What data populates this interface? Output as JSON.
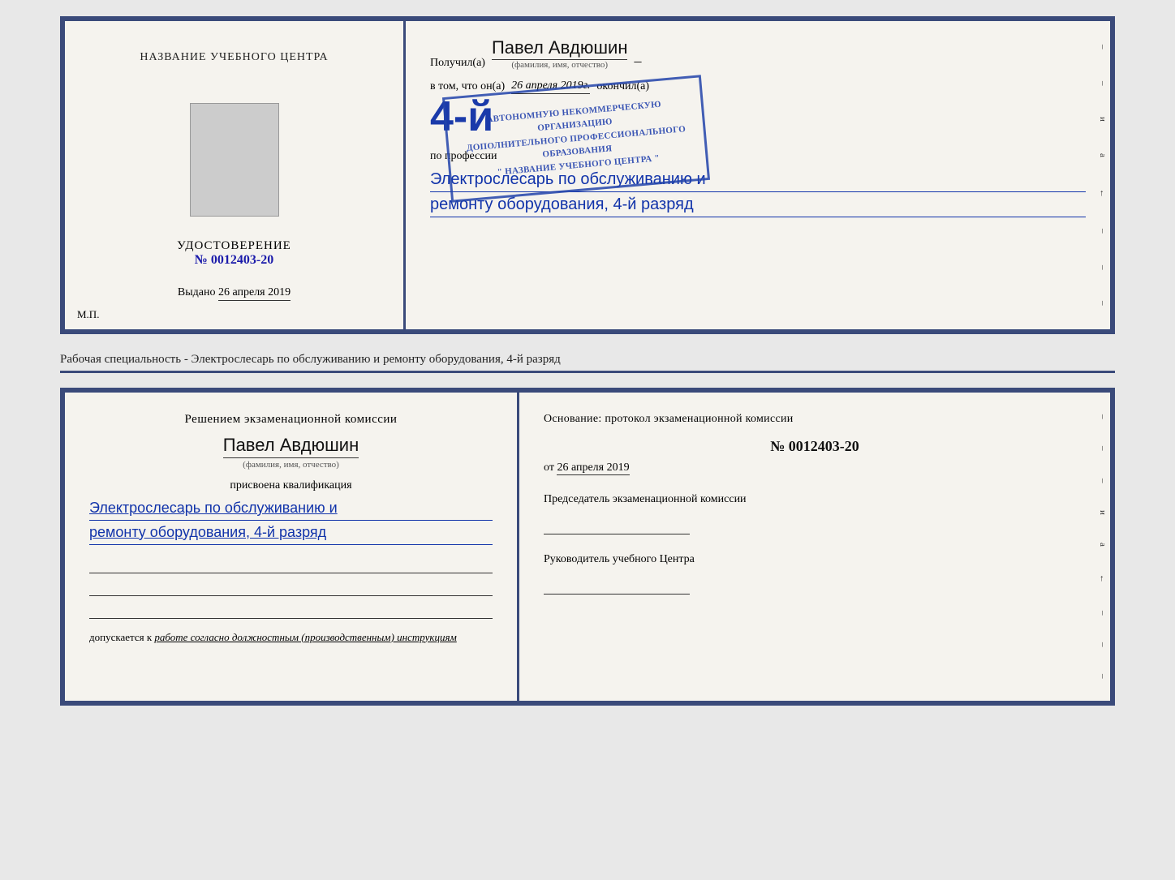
{
  "top_cert": {
    "left": {
      "title": "НАЗВАНИЕ УЧЕБНОГО ЦЕНТРА",
      "udostoverenie_label": "УДОСТОВЕРЕНИЕ",
      "number": "№ 0012403-20",
      "vydano_label": "Выдано",
      "vydano_date": "26 апреля 2019",
      "mp_label": "М.П."
    },
    "right": {
      "recipient_prefix": "Получил(а)",
      "recipient_name": "Павел Авдюшин",
      "dash": "–",
      "fio_label": "(фамилия, имя, отчество)",
      "vtom_prefix": "в том, что он(а)",
      "vtom_date": "26 апреля 2019г.",
      "okonchil": "окончил(а)",
      "rank": "4-й",
      "org_line1": "АВТОНОМНУЮ НЕКОММЕРЧЕСКУЮ ОРГАНИЗАЦИЮ",
      "org_line2": "ДОПОЛНИТЕЛЬНОГО ПРОФЕССИОНАЛЬНОГО ОБРАЗОВАНИЯ",
      "org_line3": "\" НАЗВАНИЕ УЧЕБНОГО ЦЕНТРА \"",
      "po_professii": "по профессии",
      "profession_line1": "Электрослесарь по обслуживанию и",
      "profession_line2": "ремонту оборудования, 4-й разряд"
    },
    "edge_marks": [
      "–",
      "–",
      "и",
      "а",
      "←",
      "–",
      "–",
      "–"
    ]
  },
  "middle_text": "Рабочая специальность - Электрослесарь по обслуживанию и ремонту оборудования, 4-й разряд",
  "bottom_cert": {
    "left": {
      "resheniem_label": "Решением экзаменационной  комиссии",
      "person_name": "Павел Авдюшин",
      "fio_label": "(фамилия, имя, отчество)",
      "prisvoena_label": "присвоена квалификация",
      "qualification_line1": "Электрослесарь по обслуживанию и",
      "qualification_line2": "ремонту оборудования, 4-й разряд",
      "dopuskaetsya_prefix": "допускается к",
      "dopuskaetsya_text": "работе согласно должностным (производственным) инструкциям"
    },
    "right": {
      "osnovanie_label": "Основание: протокол экзаменационной  комиссии",
      "protocol_number": "№  0012403-20",
      "ot_prefix": "от",
      "ot_date": "26 апреля 2019",
      "predsedatel_label": "Председатель экзаменационной комиссии",
      "rukovoditel_label": "Руководитель учебного Центра"
    },
    "edge_marks": [
      "–",
      "–",
      "–",
      "и",
      "а",
      "←",
      "–",
      "–",
      "–"
    ]
  }
}
